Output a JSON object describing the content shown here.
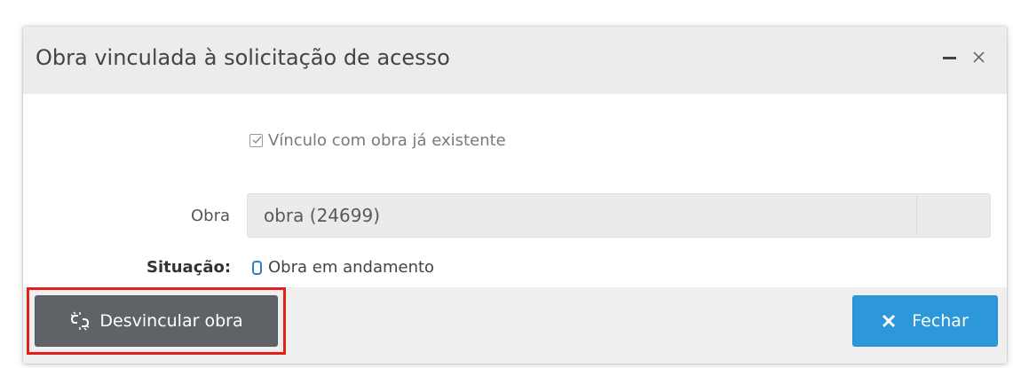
{
  "dialog": {
    "title": "Obra vinculada à solicitação de acesso",
    "minimize_icon": "minus-icon",
    "close_icon": "close-icon"
  },
  "form": {
    "checkbox_label": "Vínculo com obra já existente",
    "checkbox_checked": true,
    "obra_label": "Obra",
    "obra_value": "obra (24699)",
    "situacao_label": "Situação:",
    "situacao_value": "Obra em andamento",
    "situacao_icon_color": "#2f7fc1"
  },
  "footer": {
    "unlink_label": "Desvincular obra",
    "unlink_icon": "unlink-icon",
    "close_label": "Fechar",
    "close_icon": "x-icon",
    "highlight_color": "#e2201a",
    "close_button_color": "#2c97d9",
    "unlink_button_color": "#5f6368"
  }
}
